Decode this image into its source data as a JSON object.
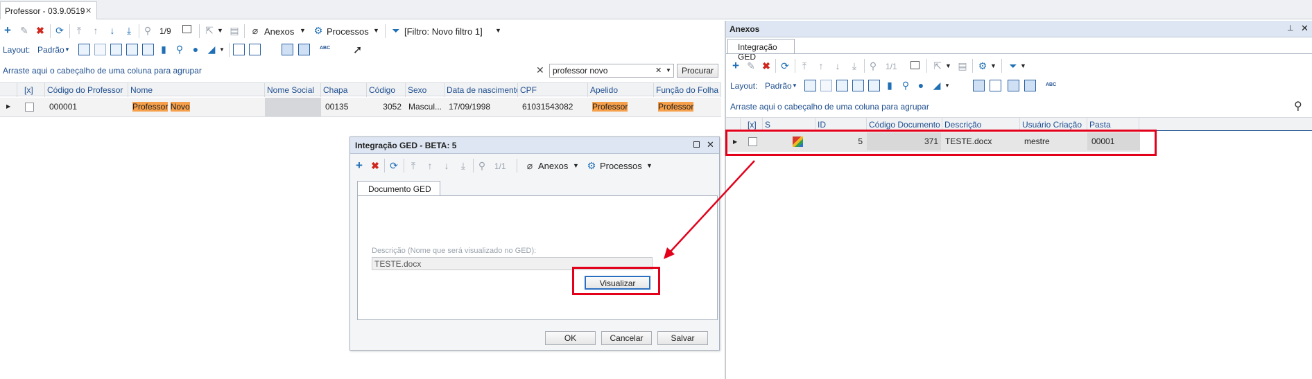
{
  "main_tab": {
    "title": "Professor - 03.9.0519",
    "close": "✕"
  },
  "toolbar": {
    "page_counter": "1/9",
    "anexos": "Anexos",
    "processos": "Processos",
    "filter": "[Filtro: Novo filtro 1]"
  },
  "layout_bar": {
    "label": "Layout:",
    "value": "Padrão"
  },
  "group_bar": {
    "text": "Arraste aqui o cabeçalho de uma coluna para agrupar",
    "search_value": "professor novo",
    "search_button": "Procurar"
  },
  "grid": {
    "columns": [
      "[x]",
      "Código do Professor",
      "Nome",
      "Nome Social",
      "Chapa",
      "Código",
      "Sexo",
      "Data de nascimento",
      "CPF",
      "Apelido",
      "Função do Folha de"
    ],
    "row": {
      "codigo": "000001",
      "nome_1": "Professor",
      "nome_2": "Novo",
      "chapa": "00135",
      "codigo_num": "3052",
      "sexo": "Mascul...",
      "nascimento": "17/09/1998",
      "cpf": "61031543082",
      "apelido": "Professor",
      "funcao": "Professor"
    }
  },
  "dialog": {
    "title": "Integração GED - BETA: 5",
    "counter": "1/1",
    "anexos": "Anexos",
    "processos": "Processos",
    "tab": "Documento GED",
    "field_label": "Descrição (Nome que será visualizado no GED):",
    "field_value": "TESTE.docx",
    "visualizar": "Visualizar",
    "ok": "OK",
    "cancelar": "Cancelar",
    "salvar": "Salvar"
  },
  "anexos_panel": {
    "title": "Anexos",
    "tab": "Integração GED",
    "counter": "1/1",
    "layout_label": "Layout:",
    "layout_value": "Padrão",
    "group_text": "Arraste aqui o cabeçalho de uma coluna para agrupar",
    "columns": [
      "[x]",
      "S",
      "ID",
      "Código Documento",
      "Descrição",
      "Usuário Criação",
      "Pasta"
    ],
    "row": {
      "id": "5",
      "codigo_documento": "371",
      "descricao": "TESTE.docx",
      "usuario": "mestre",
      "pasta": "00001"
    }
  },
  "colors": {
    "highlight": "#f7a04b",
    "annotation_red": "#e3001b",
    "accent_blue": "#1f6fb5",
    "panel_header": "#dde6f2"
  }
}
